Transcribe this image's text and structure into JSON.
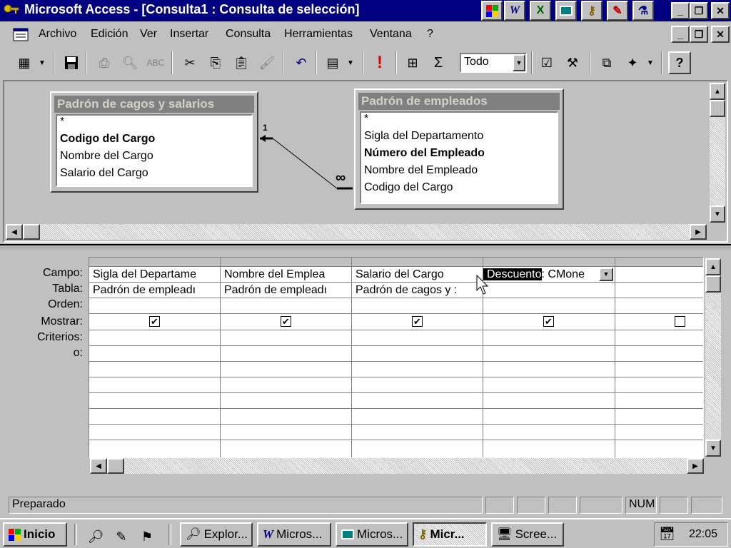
{
  "window": {
    "title": "Microsoft Access - [Consulta1 : Consulta de selección]",
    "quick_icons": [
      "office-icon",
      "word-icon",
      "excel-icon",
      "powerpoint-icon",
      "access-icon",
      "outlook-icon",
      "office-setup-icon"
    ]
  },
  "menu": {
    "items": [
      "Archivo",
      "Edición",
      "Ver",
      "Insertar",
      "Consulta",
      "Herramientas",
      "Ventana",
      "?"
    ]
  },
  "toolbar": {
    "top_values": "Todo"
  },
  "tables": [
    {
      "title": "Padrón de cagos y salarios",
      "fields": [
        "*",
        "Codigo del Cargo",
        "Nombre del Cargo",
        "Salario del Cargo"
      ],
      "key_field": "Codigo del Cargo"
    },
    {
      "title": "Padrón de empleados",
      "fields": [
        "*",
        "Sigla del Departamento",
        "Número del Empleado",
        "Nombre del Empleado",
        "Codigo del Cargo"
      ],
      "key_field": "Número del Empleado"
    }
  ],
  "relationship": {
    "one_label": "1",
    "many_label": "∞"
  },
  "grid": {
    "row_labels": [
      "Campo:",
      "Tabla:",
      "Orden:",
      "Mostrar:",
      "Criterios:",
      "o:"
    ],
    "columns": [
      {
        "campo": "Sigla del Departame",
        "tabla": "Padrón de empleadı",
        "mostrar": true
      },
      {
        "campo": "Nombre del Emplea",
        "tabla": "Padrón de empleadı",
        "mostrar": true
      },
      {
        "campo": "Salario del Cargo",
        "tabla": "Padrón de cagos y :",
        "mostrar": true
      },
      {
        "campo_selected": "Descuento",
        "campo_rest": ": CMone",
        "tabla": "",
        "mostrar": true
      },
      {
        "campo": "",
        "tabla": "",
        "mostrar": false
      }
    ]
  },
  "status": {
    "text": "Preparado",
    "num": "NUM"
  },
  "taskbar": {
    "start": "Inicio",
    "tasks": [
      "Explor...",
      "Micros...",
      "Micros...",
      "Micr...",
      "Scree..."
    ],
    "clock": "22:05"
  }
}
